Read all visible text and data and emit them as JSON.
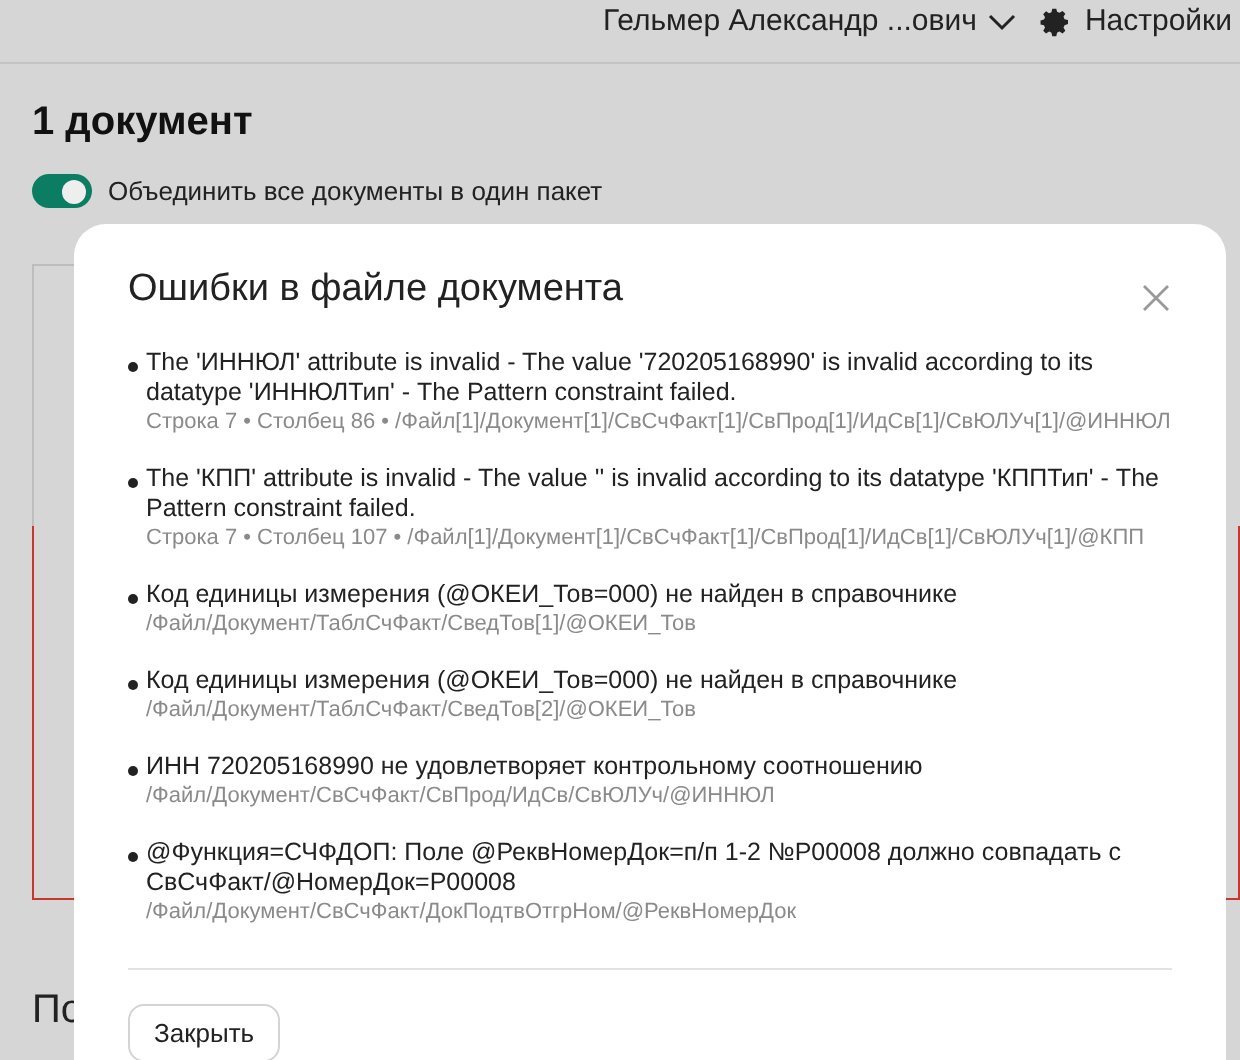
{
  "header": {
    "user": "Гельмер Александр ...ович",
    "settings": "Настройки"
  },
  "page": {
    "title": "1 документ",
    "merge_toggle": {
      "label": "Объединить все документы в один пакет",
      "on": true
    },
    "section_heading": "По"
  },
  "dialog": {
    "title": "Ошибки в файле документа",
    "errors": [
      {
        "message": "The 'ИННЮЛ' attribute is invalid - The value '720205168990' is invalid according to its datatype 'ИННЮЛТип' - The Pattern constraint failed.",
        "details": "Строка 7 • Столбец 86 • /Файл[1]/Документ[1]/СвСчФакт[1]/СвПрод[1]/ИдСв[1]/СвЮЛУч[1]/@ИННЮЛ"
      },
      {
        "message": "The 'КПП' attribute is invalid - The value '' is invalid according to its datatype 'КППТип' - The Pattern constraint failed.",
        "details": "Строка 7 • Столбец 107 • /Файл[1]/Документ[1]/СвСчФакт[1]/СвПрод[1]/ИдСв[1]/СвЮЛУч[1]/@КПП"
      },
      {
        "message": "Код единицы измерения (@ОКЕИ_Тов=000) не найден в справочнике",
        "details": "/Файл/Документ/ТаблСчФакт/СведТов[1]/@ОКЕИ_Тов"
      },
      {
        "message": "Код единицы измерения (@ОКЕИ_Тов=000) не найден в справочнике",
        "details": "/Файл/Документ/ТаблСчФакт/СведТов[2]/@ОКЕИ_Тов"
      },
      {
        "message": "ИНН 720205168990 не удовлетворяет контрольному соотношению",
        "details": "/Файл/Документ/СвСчФакт/СвПрод/ИдСв/СвЮЛУч/@ИННЮЛ"
      },
      {
        "message": "@Функция=СЧФДОП: Поле @РеквНомерДок=п/п 1-2 №P00008 должно совпадать с СвСчФакт/@НомерДок=P00008",
        "details": "/Файл/Документ/СвСчФакт/ДокПодтвОтгрНом/@РеквНомерДок"
      }
    ],
    "close_button": "Закрыть"
  }
}
